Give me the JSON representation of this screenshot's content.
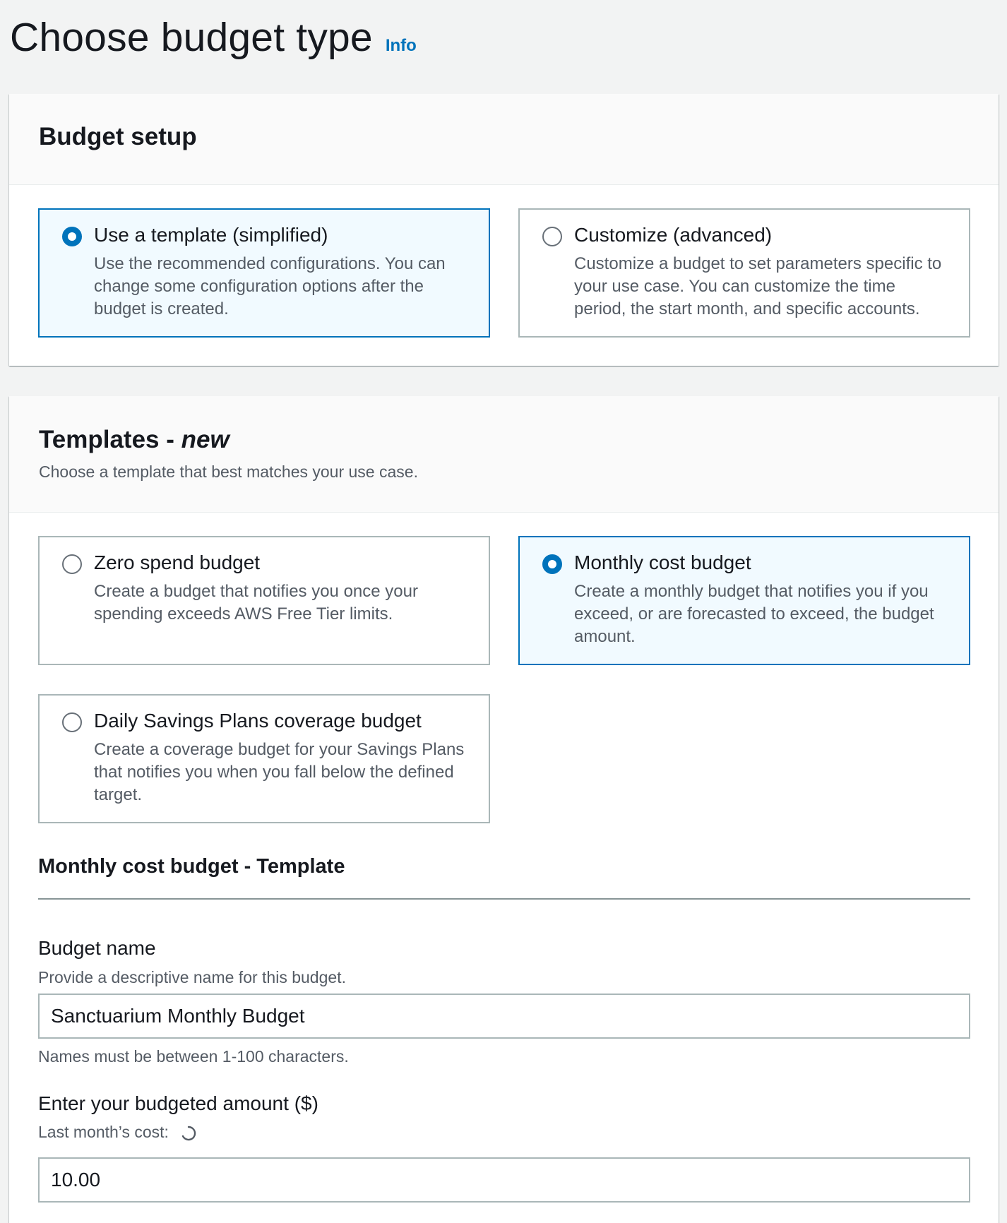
{
  "header": {
    "title": "Choose budget type",
    "info_label": "Info"
  },
  "budget_setup": {
    "title": "Budget setup",
    "options": [
      {
        "label": "Use a template (simplified)",
        "description": "Use the recommended configurations. You can change some configuration options after the budget is created.",
        "selected": true
      },
      {
        "label": "Customize (advanced)",
        "description": "Customize a budget to set parameters specific to your use case. You can customize the time period, the start month, and specific accounts.",
        "selected": false
      }
    ]
  },
  "templates": {
    "title": "Templates - ",
    "title_badge": "new",
    "subtitle": "Choose a template that best matches your use case.",
    "options": [
      {
        "label": "Zero spend budget",
        "description": "Create a budget that notifies you once your spending exceeds AWS Free Tier limits.",
        "selected": false
      },
      {
        "label": "Monthly cost budget",
        "description": "Create a monthly budget that notifies you if you exceed, or are forecasted to exceed, the budget amount.",
        "selected": true
      },
      {
        "label": "Daily Savings Plans coverage budget",
        "description": "Create a coverage budget for your Savings Plans that notifies you when you fall below the defined target.",
        "selected": false
      }
    ]
  },
  "template_form": {
    "section_title": "Monthly cost budget - Template",
    "budget_name": {
      "label": "Budget name",
      "description": "Provide a descriptive name for this budget.",
      "value": "Sanctuarium Monthly Budget",
      "constraint": "Names must be between 1-100 characters."
    },
    "budget_amount": {
      "label": "Enter your budgeted amount ($)",
      "last_month_label": "Last month’s cost:",
      "value": "10.00"
    }
  },
  "colors": {
    "accent": "#0073bb",
    "selected_tile_bg": "#f1faff",
    "page_bg": "#f2f3f3"
  }
}
